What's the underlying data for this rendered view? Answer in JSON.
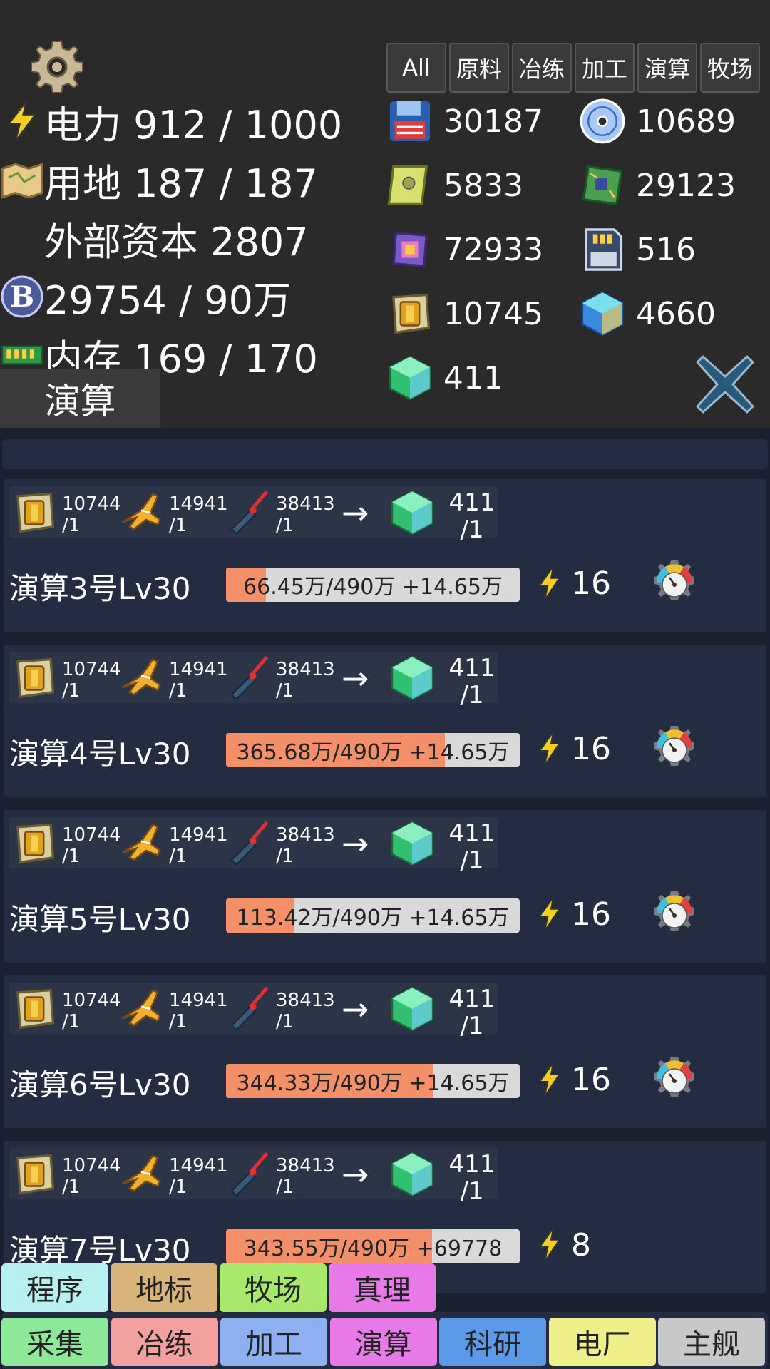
{
  "header": {
    "stats": {
      "power": "电力 912 / 1000",
      "land": "用地 187 / 187",
      "capital": "外部资本 2807",
      "coins": "29754 / 90万",
      "memory": "内存 169 / 170"
    },
    "category_tabs": [
      "All",
      "原料",
      "冶练",
      "加工",
      "演算",
      "牧场"
    ],
    "resources": [
      "30187",
      "10689",
      "5833",
      "29123",
      "72933",
      "516",
      "10745",
      "4660",
      "411"
    ],
    "section_tab": "演算"
  },
  "recipe": {
    "inputs": [
      {
        "amount": "10744",
        "per": "/1",
        "icon": "chip-board-icon"
      },
      {
        "amount": "14941",
        "per": "/1",
        "icon": "jet-icon"
      },
      {
        "amount": "38413",
        "per": "/1",
        "icon": "laser-pen-icon"
      }
    ],
    "arrow": "→",
    "output": {
      "amount": "411",
      "per": "/1",
      "icon": "green-cube-icon"
    }
  },
  "machines": [
    {
      "name": "演算3号Lv30",
      "progress_text": "66.45万/490万 +14.65万",
      "progress": 0.136,
      "power": "16"
    },
    {
      "name": "演算4号Lv30",
      "progress_text": "365.68万/490万 +14.65万",
      "progress": 0.746,
      "power": "16"
    },
    {
      "name": "演算5号Lv30",
      "progress_text": "113.42万/490万 +14.65万",
      "progress": 0.231,
      "power": "16"
    },
    {
      "name": "演算6号Lv30",
      "progress_text": "344.33万/490万 +14.65万",
      "progress": 0.703,
      "power": "16"
    },
    {
      "name": "演算7号Lv30",
      "progress_text": "343.55万/490万 +69778",
      "progress": 0.701,
      "power": "8"
    }
  ],
  "nav_top": [
    "程序",
    "地标",
    "牧场",
    "真理"
  ],
  "nav_bottom": [
    "采集",
    "冶练",
    "加工",
    "演算",
    "科研",
    "电厂",
    "主舰"
  ],
  "colors": {
    "header_bg": "#2a2a2a",
    "card_bg": "#232c40",
    "progress_fill": "#f3906a",
    "progress_track": "#d9d9d9",
    "nav_top": [
      "#b8f0f0",
      "#d9b47a",
      "#a8e86a",
      "#e879e8"
    ],
    "nav_bottom": [
      "#8ee89a",
      "#f2a0a0",
      "#8fb0f0",
      "#e879e8",
      "#5a9ae8",
      "#f0f08a",
      "#c8c8c8"
    ]
  }
}
